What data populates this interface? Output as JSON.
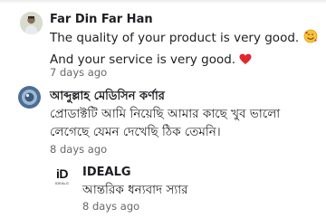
{
  "comments": [
    {
      "author": "Far Din Far Han",
      "line1": "The quality of your product is very good.",
      "line2": "And your service is very good.",
      "emoji1": "smiling-face-with-hearts",
      "emoji2": "red-heart",
      "time": "7 days ago"
    },
    {
      "author": "আব্দুল্লাহ মেডিসিন কর্ণার",
      "line1": "প্রোডাক্টটি আমি নিয়েছি আমার কাছে খুব ভালো",
      "line2": "লেগেছে যেমন দেখেছি ঠিক তেমনি।",
      "time": "8 days ago"
    }
  ],
  "reply": {
    "author": "IDEALG",
    "logo_text": "iD",
    "logo_sub": "IDEALG",
    "text": "আন্তরিক ধন্যবাদ স্যার",
    "time": "8 days ago"
  },
  "colors": {
    "meta": "#65676b",
    "text": "#1c1e21",
    "heart": "#e3262f"
  }
}
